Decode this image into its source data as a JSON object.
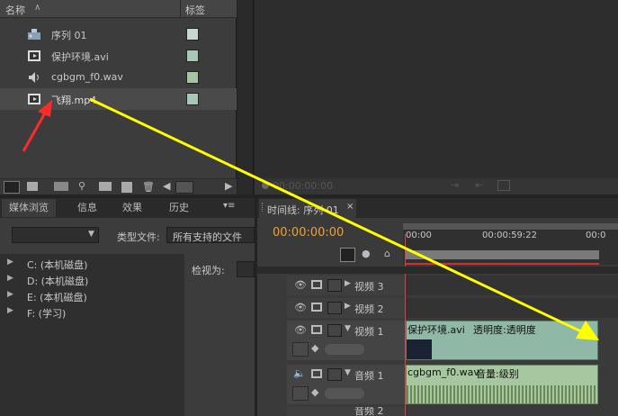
{
  "project_panel": {
    "columns": {
      "name": "名称",
      "tag": "标签"
    },
    "items": [
      {
        "label": "序列 01",
        "icon": "sequence-icon",
        "color": "#c5d7d0"
      },
      {
        "label": "保护环境.avi",
        "icon": "video-file-icon",
        "color": "#a9c7b6"
      },
      {
        "label": "cgbgm_f0.wav",
        "icon": "audio-file-icon",
        "color": "#a6c5a4"
      },
      {
        "label": "飞翔.mp4",
        "icon": "video-file-icon",
        "color": "#a9c7b6"
      }
    ]
  },
  "program_monitor": {
    "timecode": "00:00:00:00"
  },
  "left_lower_panel": {
    "tabs": [
      "媒体浏览",
      "信息",
      "效果",
      "历史"
    ],
    "file_type_label": "类型文件:",
    "file_type_value": "所有支持的文件",
    "view_as_label": "检视为:",
    "drives": [
      "C: (本机磁盘)",
      "D: (本机磁盘)",
      "E: (本机磁盘)",
      "F: (学习)"
    ]
  },
  "timeline": {
    "tab_label": "时间线: 序列 01",
    "timecode": "00:00:00:00",
    "ruler": [
      "00:00",
      "00:00:59:22",
      "00:0"
    ],
    "tracks": [
      {
        "name": "视频 3"
      },
      {
        "name": "视频 2"
      },
      {
        "name": "视频 1"
      },
      {
        "name": "音频 1"
      },
      {
        "name": "音频 2"
      }
    ],
    "clips": {
      "video1": {
        "name": "保护环境.avi",
        "effect": "透明度:透明度"
      },
      "audio1": {
        "name": "cgbgm_f0.wav",
        "effect": "音量:级别"
      }
    }
  },
  "colors": {
    "annotation_arrow": "#ff2a2a",
    "drag_arrow": "#ffff00",
    "timecode_orange": "#f0a030",
    "video_clip": "#8fb8a6",
    "audio_clip": "#a6c7a0",
    "playhead": "#e04040"
  }
}
